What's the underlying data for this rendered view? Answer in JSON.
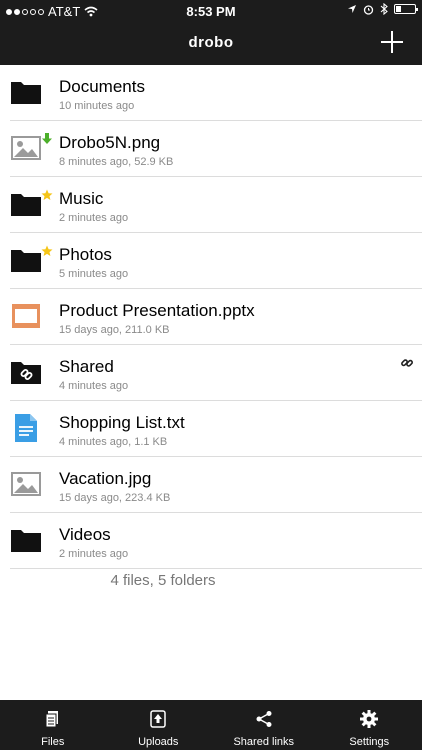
{
  "status": {
    "carrier": "AT&T",
    "time": "8:53 PM",
    "signal_bars": 2,
    "battery_level": 0.25
  },
  "nav": {
    "logo": "drobo",
    "add_icon": "plus-icon"
  },
  "files": [
    {
      "name": "Documents",
      "meta": "10 minutes ago",
      "icon": "folder-icon",
      "badge": null,
      "shared": false
    },
    {
      "name": "Drobo5N.png",
      "meta": "8 minutes ago, 52.9 KB",
      "icon": "image-icon",
      "badge": "download-arrow-icon",
      "shared": false
    },
    {
      "name": "Music",
      "meta": "2 minutes ago",
      "icon": "folder-icon",
      "badge": "star-icon",
      "shared": false
    },
    {
      "name": "Photos",
      "meta": "5 minutes ago",
      "icon": "folder-icon",
      "badge": "star-icon",
      "shared": false
    },
    {
      "name": "Product Presentation.pptx",
      "meta": "15 days ago, 211.0 KB",
      "icon": "presentation-icon",
      "badge": null,
      "shared": false
    },
    {
      "name": "Shared",
      "meta": "4 minutes ago",
      "icon": "shared-folder-icon",
      "badge": null,
      "shared": true
    },
    {
      "name": "Shopping List.txt",
      "meta": "4 minutes ago, 1.1 KB",
      "icon": "text-file-icon",
      "badge": null,
      "shared": false
    },
    {
      "name": "Vacation.jpg",
      "meta": "15 days ago, 223.4 KB",
      "icon": "image-icon",
      "badge": null,
      "shared": false
    },
    {
      "name": "Videos",
      "meta": "2 minutes ago",
      "icon": "folder-icon",
      "badge": null,
      "shared": false
    }
  ],
  "summary": "4 files, 5 folders",
  "tabs": [
    {
      "label": "Files",
      "icon": "files-icon"
    },
    {
      "label": "Uploads",
      "icon": "upload-icon"
    },
    {
      "label": "Shared links",
      "icon": "share-icon"
    },
    {
      "label": "Settings",
      "icon": "gear-icon"
    }
  ],
  "colors": {
    "bar": "#1c1c1c",
    "folder": "#111111",
    "image_icon": "#9a9a9a",
    "presentation": "#e8915d",
    "text_file": "#3a9ee5",
    "star": "#f5c518",
    "download_arrow": "#4caf2a"
  }
}
